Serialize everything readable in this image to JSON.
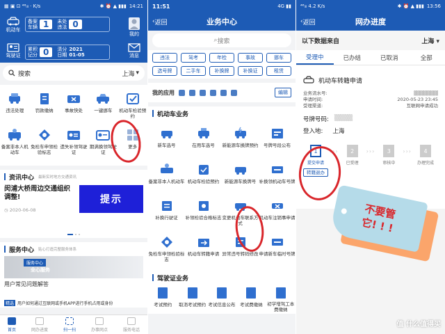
{
  "p1": {
    "status": {
      "left": "▦ ▣ ⊡ ⁴⁶ᵢₗₗ ⋅ K/s",
      "time": "14:21",
      "right": "✱ ⏰ ▲ ▮▮▮"
    },
    "side_left": [
      {
        "label": "机动车",
        "icon": "car-icon"
      },
      {
        "label": "驾驶证",
        "icon": "id-card-icon"
      }
    ],
    "side_right": [
      {
        "label": "我的",
        "icon": "avatar-icon"
      },
      {
        "label": "消息",
        "icon": "mail-icon"
      }
    ],
    "box1": {
      "label": "备案\n车辆",
      "count": "1",
      "sub": "未处\n违法",
      "sub_count": "0"
    },
    "box2": {
      "label": "累积\n记分",
      "count": "0",
      "sub": "清分\n日期",
      "date_year": "2021",
      "date": "01-05"
    },
    "search_label": "搜索",
    "city": "上海",
    "services": [
      "违法处理",
      "罚款缴纳",
      "事故快处",
      "一键挪车",
      "机动车检验预约",
      "备案非本人机动车",
      "免检车申领检验标志",
      "遗失补领驾驶证",
      "期满换领驾驶证",
      "更多"
    ],
    "info_title": "资讯中心",
    "info_sub": "最新实时地方交通资讯",
    "news_title": "闵浦大桥周边交通组织调整!",
    "news_date": "2020-06-08",
    "news_banner": "提示",
    "service_title": "服务中心",
    "service_sub": "贴心打造完整服务体系",
    "service_badge": "服务中心",
    "service_badge2": "全心服务",
    "faq_title": "用户常见问题解答",
    "faq_tag": "精选",
    "faq_text": "用户如何通过互联网或手机APP进行手机占用或身份",
    "tabs": [
      "首页",
      "网办进度",
      "扫一扫",
      "办事网点",
      "服务电话"
    ]
  },
  "p2": {
    "status": {
      "time": "11:51",
      "right": "4G ▮▮"
    },
    "back": "返回",
    "title": "业务中心",
    "search_placeholder": "搜索",
    "tags": [
      "违法",
      "驾考",
      "年检",
      "事故",
      "挪车",
      "选号牌",
      "二手车",
      "补换牌",
      "补换证",
      "租赁"
    ],
    "my_apps": "我的应用",
    "edit": "编辑",
    "vehicle_title": "机动车业务",
    "vehicle_items": [
      "新车选号",
      "在用车选号",
      "新能源车换牌预约",
      "号牌号段公布",
      "备案非本人机动车",
      "机动车检验预约",
      "新能源车换牌号",
      "补换领机动车号牌",
      "补换行驶证",
      "补领检验合格标志",
      "变更机动车联系方式",
      "机动车注销事申请",
      "免检车申领检验标志",
      "机动车转籍申请",
      "异常违号转码修改",
      "申请新车临时号牌"
    ],
    "license_title": "驾驶证业务",
    "license_items": [
      "考试预约",
      "取消考试预约",
      "考试信息公布",
      "考试费缴纳",
      "初学增驾工本费缴纳"
    ]
  },
  "p3": {
    "status": {
      "left": "⁴⁶ᵢₗₗ 4.2 K/s",
      "time": "13:56",
      "right": "✱ ⏰ ▲ ▮▮▮"
    },
    "back": "返回",
    "title": "网办进度",
    "source_label": "以下数据来自",
    "source_city": "上海",
    "tabs": [
      "受理中",
      "已办结",
      "已取消",
      "全部"
    ],
    "item_title": "机动车转籍申请",
    "fields": [
      {
        "k": "业务流水号:",
        "v": "▓▓▓▓▓▓▓"
      },
      {
        "k": "申请时间:",
        "v": "2020-05-23 23:45"
      },
      {
        "k": "受理渠道:",
        "v": "互联网申请成功"
      }
    ],
    "plate_label": "号牌号码:",
    "plate_value": "▒▒▒▒",
    "city_label": "登入地:",
    "city_value": "上海",
    "steps": [
      {
        "n": "1",
        "label": "提交申请"
      },
      {
        "n": "2",
        "label": "已受理"
      },
      {
        "n": "3",
        "label": "审核中"
      },
      {
        "n": "4",
        "label": "办理完成"
      }
    ],
    "cancel_btn": "转籍退办",
    "sticker_text": "不要管\n它! ! !",
    "watermark": "值 什么值得买"
  }
}
